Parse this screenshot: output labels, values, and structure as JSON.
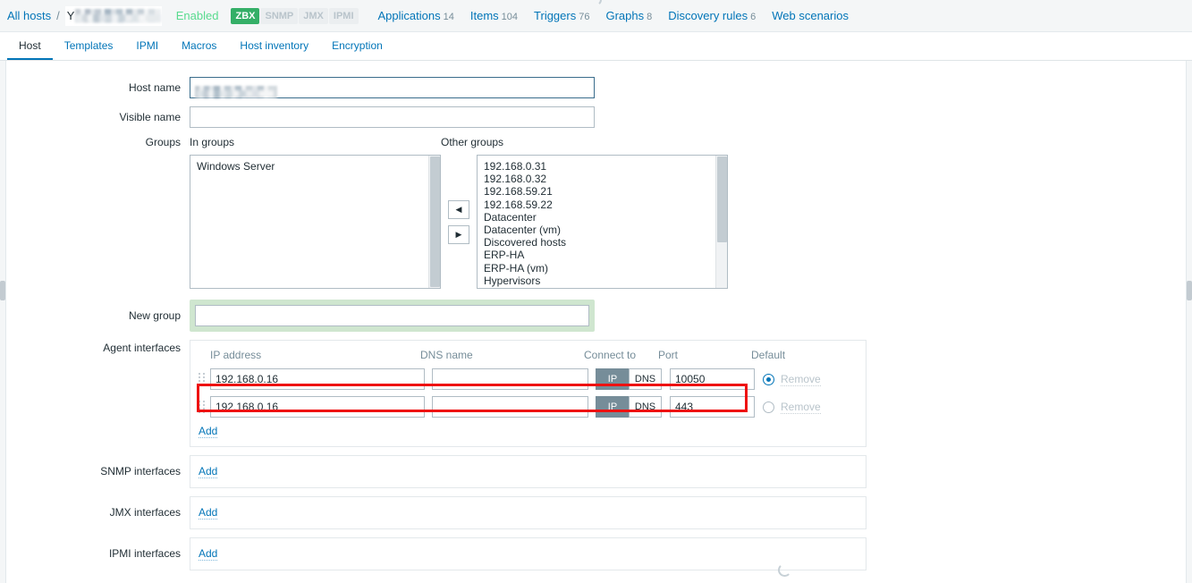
{
  "header": {
    "breadcrumb_root": "All hosts",
    "separator": "/",
    "host_name_masked": "Y",
    "status": "Enabled",
    "badges": [
      {
        "label": "ZBX",
        "state": "on"
      },
      {
        "label": "SNMP",
        "state": "off"
      },
      {
        "label": "JMX",
        "state": "off"
      },
      {
        "label": "IPMI",
        "state": "off"
      }
    ],
    "nav": [
      {
        "label": "Applications",
        "count": "14"
      },
      {
        "label": "Items",
        "count": "104"
      },
      {
        "label": "Triggers",
        "count": "76"
      },
      {
        "label": "Graphs",
        "count": "8"
      },
      {
        "label": "Discovery rules",
        "count": "6"
      },
      {
        "label": "Web scenarios",
        "count": ""
      }
    ]
  },
  "tabs": [
    {
      "label": "Host",
      "active": true
    },
    {
      "label": "Templates",
      "active": false
    },
    {
      "label": "IPMI",
      "active": false
    },
    {
      "label": "Macros",
      "active": false
    },
    {
      "label": "Host inventory",
      "active": false
    },
    {
      "label": "Encryption",
      "active": false
    }
  ],
  "form": {
    "host_name": {
      "label": "Host name",
      "value": "",
      "placeholder": ""
    },
    "visible_name": {
      "label": "Visible name",
      "value": "",
      "placeholder": ""
    },
    "groups": {
      "label": "Groups",
      "in_groups_label": "In groups",
      "other_groups_label": "Other groups",
      "in_groups": [
        "Windows Server"
      ],
      "other_groups": [
        "192.168.0.31",
        "192.168.0.32",
        "192.168.59.21",
        "192.168.59.22",
        "Datacenter",
        "Datacenter (vm)",
        "Discovered hosts",
        "ERP-HA",
        "ERP-HA (vm)",
        "Hypervisors"
      ],
      "move_left_icon": "arrow-left-icon",
      "move_right_icon": "arrow-right-icon"
    },
    "new_group": {
      "label": "New group",
      "value": "",
      "placeholder": ""
    },
    "agent_interfaces": {
      "label": "Agent interfaces",
      "columns": {
        "ip": "IP address",
        "dns": "DNS name",
        "connect_to": "Connect to",
        "port": "Port",
        "default": "Default"
      },
      "connect_options": {
        "ip": "IP",
        "dns": "DNS"
      },
      "rows": [
        {
          "ip": "192.168.0.16",
          "dns": "",
          "connect_to": "IP",
          "port": "10050",
          "is_default": true,
          "remove_label": "Remove",
          "highlighted": false
        },
        {
          "ip": "192.168.0.16",
          "dns": "",
          "connect_to": "IP",
          "port": "443",
          "is_default": false,
          "remove_label": "Remove",
          "highlighted": true
        }
      ],
      "add_label": "Add"
    },
    "snmp_interfaces": {
      "label": "SNMP interfaces",
      "add_label": "Add"
    },
    "jmx_interfaces": {
      "label": "JMX interfaces",
      "add_label": "Add"
    },
    "ipmi_interfaces": {
      "label": "IPMI interfaces",
      "add_label": "Add"
    }
  },
  "colors": {
    "accent_link": "#0275b8",
    "enabled_green": "#59db8f",
    "badge_green": "#34af67",
    "highlight_red": "#ee1111",
    "newgroup_green": "#cfe6cf",
    "toggle_selected": "#768d99"
  }
}
